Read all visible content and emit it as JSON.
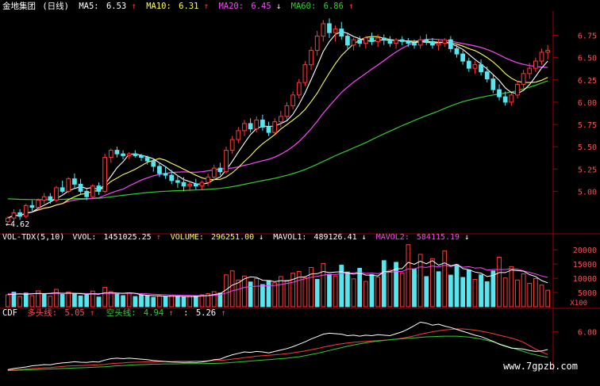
{
  "header": {
    "stock_name": "金地集团",
    "period": "(日线)",
    "ma5": {
      "label": "MA5:",
      "value": "6.53",
      "arrow": "↑"
    },
    "ma10": {
      "label": "MA10:",
      "value": "6.31",
      "arrow": "↑"
    },
    "ma20": {
      "label": "MA20:",
      "value": "6.45",
      "arrow": "↓"
    },
    "ma60": {
      "label": "MA60:",
      "value": "6.86",
      "arrow": "↑"
    }
  },
  "volume_header": {
    "indicator": "VOL-TDX(5,10)",
    "vvol": {
      "label": "VVOL:",
      "value": "1451025.25",
      "arrow": "↑"
    },
    "volume": {
      "label": "VOLUME:",
      "value": "296251.00",
      "arrow": "↓"
    },
    "mavol1": {
      "label": "MAVOL1:",
      "value": "489126.41",
      "arrow": "↓"
    },
    "mavol2": {
      "label": "MAVOL2:",
      "value": "584115.19",
      "arrow": "↓"
    }
  },
  "cdf_header": {
    "indicator": "CDF",
    "long_line": {
      "label": "多头线:",
      "value": "5.05",
      "arrow": "↑"
    },
    "short_line": {
      "label": "空头线:",
      "value": "4.94",
      "arrow": "↑"
    },
    "third": {
      "label": ":",
      "value": "5.26",
      "arrow": "↑"
    }
  },
  "low_marker": "←4.62",
  "watermark": "www.7gpzb.com",
  "colors": {
    "up": "#ff3b3b",
    "down": "#55e6ef",
    "ma5": "#ffffff",
    "ma10": "#ffff55",
    "ma20": "#ff44ff",
    "ma60": "#33cc33",
    "axis": "#a00000",
    "label": "#ff5050",
    "background": "#000000"
  },
  "chart_data": [
    {
      "type": "candlestick",
      "title": "金地集团 (日线)",
      "y_ticks": [
        "6.75",
        "6.50",
        "6.25",
        "6.00",
        "5.75",
        "5.50",
        "5.25",
        "5.00"
      ],
      "ylim": [
        4.55,
        6.95
      ],
      "candles": [
        [
          4.66,
          4.72,
          4.62,
          4.7
        ],
        [
          4.7,
          4.8,
          4.66,
          4.76
        ],
        [
          4.76,
          4.8,
          4.68,
          4.72
        ],
        [
          4.72,
          4.86,
          4.7,
          4.84
        ],
        [
          4.84,
          4.9,
          4.78,
          4.82
        ],
        [
          4.82,
          4.92,
          4.8,
          4.9
        ],
        [
          4.9,
          4.98,
          4.86,
          4.94
        ],
        [
          4.94,
          4.98,
          4.86,
          4.9
        ],
        [
          4.9,
          5.06,
          4.88,
          5.04
        ],
        [
          5.04,
          5.12,
          4.98,
          5.0
        ],
        [
          5.0,
          5.16,
          4.98,
          5.14
        ],
        [
          5.14,
          5.2,
          5.04,
          5.08
        ],
        [
          5.08,
          5.14,
          4.96,
          5.0
        ],
        [
          5.0,
          5.04,
          4.9,
          4.94
        ],
        [
          4.94,
          5.08,
          4.92,
          5.06
        ],
        [
          5.06,
          5.1,
          4.96,
          5.0
        ],
        [
          5.0,
          5.42,
          4.98,
          5.38
        ],
        [
          5.38,
          5.48,
          5.32,
          5.46
        ],
        [
          5.46,
          5.5,
          5.38,
          5.42
        ],
        [
          5.42,
          5.46,
          5.36,
          5.4
        ],
        [
          5.4,
          5.44,
          5.36,
          5.42
        ],
        [
          5.42,
          5.46,
          5.38,
          5.4
        ],
        [
          5.4,
          5.42,
          5.34,
          5.38
        ],
        [
          5.38,
          5.4,
          5.3,
          5.34
        ],
        [
          5.34,
          5.36,
          5.22,
          5.28
        ],
        [
          5.28,
          5.32,
          5.16,
          5.2
        ],
        [
          5.2,
          5.28,
          5.14,
          5.18
        ],
        [
          5.18,
          5.24,
          5.08,
          5.12
        ],
        [
          5.12,
          5.18,
          5.04,
          5.1
        ],
        [
          5.1,
          5.16,
          5.0,
          5.06
        ],
        [
          5.06,
          5.12,
          5.0,
          5.08
        ],
        [
          5.08,
          5.14,
          5.02,
          5.06
        ],
        [
          5.06,
          5.12,
          5.02,
          5.1
        ],
        [
          5.1,
          5.2,
          5.06,
          5.16
        ],
        [
          5.16,
          5.3,
          5.12,
          5.26
        ],
        [
          5.26,
          5.32,
          5.18,
          5.22
        ],
        [
          5.22,
          5.5,
          5.2,
          5.46
        ],
        [
          5.46,
          5.62,
          5.42,
          5.58
        ],
        [
          5.58,
          5.72,
          5.54,
          5.68
        ],
        [
          5.68,
          5.8,
          5.62,
          5.76
        ],
        [
          5.76,
          5.82,
          5.66,
          5.7
        ],
        [
          5.7,
          5.84,
          5.66,
          5.8
        ],
        [
          5.8,
          5.86,
          5.68,
          5.72
        ],
        [
          5.72,
          5.78,
          5.62,
          5.66
        ],
        [
          5.66,
          5.82,
          5.64,
          5.78
        ],
        [
          5.78,
          5.9,
          5.72,
          5.84
        ],
        [
          5.84,
          6.0,
          5.8,
          5.96
        ],
        [
          5.96,
          6.12,
          5.92,
          6.08
        ],
        [
          6.08,
          6.26,
          6.04,
          6.22
        ],
        [
          6.22,
          6.46,
          6.18,
          6.42
        ],
        [
          6.42,
          6.62,
          6.36,
          6.58
        ],
        [
          6.58,
          6.8,
          6.52,
          6.74
        ],
        [
          6.74,
          6.92,
          6.68,
          6.88
        ],
        [
          6.88,
          6.94,
          6.72,
          6.78
        ],
        [
          6.78,
          6.86,
          6.68,
          6.82
        ],
        [
          6.82,
          6.9,
          6.7,
          6.74
        ],
        [
          6.74,
          6.78,
          6.6,
          6.64
        ],
        [
          6.64,
          6.72,
          6.58,
          6.7
        ],
        [
          6.7,
          6.74,
          6.62,
          6.66
        ],
        [
          6.66,
          6.74,
          6.6,
          6.72
        ],
        [
          6.72,
          6.78,
          6.64,
          6.68
        ],
        [
          6.68,
          6.76,
          6.62,
          6.72
        ],
        [
          6.72,
          6.76,
          6.64,
          6.7
        ],
        [
          6.7,
          6.74,
          6.62,
          6.66
        ],
        [
          6.66,
          6.72,
          6.6,
          6.7
        ],
        [
          6.7,
          6.74,
          6.64,
          6.68
        ],
        [
          6.68,
          6.72,
          6.62,
          6.66
        ],
        [
          6.66,
          6.7,
          6.6,
          6.64
        ],
        [
          6.64,
          6.74,
          6.6,
          6.7
        ],
        [
          6.7,
          6.76,
          6.64,
          6.68
        ],
        [
          6.68,
          6.72,
          6.6,
          6.64
        ],
        [
          6.64,
          6.7,
          6.58,
          6.66
        ],
        [
          6.66,
          6.72,
          6.62,
          6.7
        ],
        [
          6.7,
          6.74,
          6.56,
          6.6
        ],
        [
          6.6,
          6.64,
          6.5,
          6.54
        ],
        [
          6.54,
          6.58,
          6.42,
          6.46
        ],
        [
          6.46,
          6.5,
          6.34,
          6.38
        ],
        [
          6.38,
          6.46,
          6.32,
          6.42
        ],
        [
          6.42,
          6.48,
          6.3,
          6.34
        ],
        [
          6.34,
          6.4,
          6.22,
          6.26
        ],
        [
          6.26,
          6.3,
          6.1,
          6.14
        ],
        [
          6.14,
          6.2,
          6.02,
          6.06
        ],
        [
          6.06,
          6.12,
          5.96,
          6.0
        ],
        [
          6.0,
          6.1,
          5.96,
          6.08
        ],
        [
          6.08,
          6.24,
          6.04,
          6.2
        ],
        [
          6.2,
          6.36,
          6.16,
          6.32
        ],
        [
          6.32,
          6.44,
          6.26,
          6.38
        ],
        [
          6.38,
          6.5,
          6.34,
          6.46
        ],
        [
          6.46,
          6.6,
          6.42,
          6.56
        ],
        [
          6.56,
          6.64,
          6.48,
          6.58
        ]
      ]
    },
    {
      "type": "bar",
      "title": "VOL-TDX(5,10)",
      "y_ticks": [
        "20000",
        "15000",
        "10000",
        "5000"
      ],
      "unit": "X100",
      "ylim": [
        0,
        22000
      ],
      "values": [
        4200,
        5100,
        3600,
        4800,
        3900,
        5600,
        4400,
        3700,
        6100,
        4300,
        5200,
        4600,
        3800,
        4100,
        5500,
        3400,
        6800,
        5300,
        4400,
        3900,
        4700,
        3600,
        4200,
        3800,
        3300,
        3900,
        3500,
        4100,
        3700,
        3400,
        3600,
        3900,
        4200,
        4600,
        5300,
        4800,
        11200,
        12600,
        9400,
        10800,
        8700,
        9900,
        7800,
        9200,
        8400,
        10600,
        9300,
        11800,
        12400,
        10200,
        13800,
        9600,
        15200,
        11400,
        10800,
        14600,
        12200,
        9800,
        13500,
        8900,
        11300,
        10400,
        16200,
        12800,
        15600,
        11900,
        21800,
        13200,
        18400,
        10600,
        16900,
        12300,
        19600,
        11100,
        14800,
        10300,
        12900,
        9600,
        11200,
        8800,
        12600,
        17400,
        10100,
        14100,
        9400,
        11600,
        8200,
        9900,
        7600,
        5800
      ],
      "up_flags": [
        1,
        0,
        1,
        0,
        1,
        1,
        0,
        1,
        1,
        0,
        1,
        0,
        0,
        0,
        1,
        0,
        1,
        1,
        0,
        0,
        1,
        0,
        0,
        0,
        0,
        1,
        0,
        1,
        0,
        0,
        1,
        0,
        1,
        1,
        1,
        0,
        1,
        1,
        1,
        1,
        0,
        1,
        0,
        0,
        1,
        1,
        1,
        1,
        1,
        1,
        1,
        0,
        1,
        0,
        1,
        0,
        0,
        1,
        0,
        1,
        0,
        1,
        0,
        1,
        0,
        1,
        1,
        0,
        1,
        0,
        1,
        0,
        1,
        0,
        0,
        0,
        0,
        1,
        0,
        0,
        0,
        1,
        1,
        1,
        1,
        1,
        1,
        1,
        1,
        1
      ],
      "mavol1": [
        4300,
        4400,
        4500,
        4400,
        4500,
        4700,
        4600,
        4700,
        4900,
        4700,
        4800,
        4700,
        4600,
        4400,
        4500,
        4400,
        4900,
        4900,
        4800,
        4700,
        4900,
        4700,
        4200,
        4000,
        3900,
        3800,
        3700,
        3700,
        3700,
        3600,
        3600,
        3600,
        3800,
        3900,
        4300,
        4600,
        6000,
        7600,
        8400,
        9800,
        10500,
        10300,
        9300,
        9200,
        8800,
        9200,
        9000,
        9600,
        10400,
        10500,
        11500,
        11600,
        12400,
        12000,
        12200,
        12300,
        11800,
        11500,
        11900,
        11100,
        11100,
        10800,
        12300,
        12400,
        13300,
        13400,
        15600,
        14900,
        16000,
        15100,
        16200,
        14600,
        15400,
        14400,
        14900,
        13400,
        13000,
        12200,
        11800,
        10600,
        11000,
        12000,
        12000,
        12900,
        12700,
        12500,
        11300,
        10600,
        9200,
        8400
      ],
      "mavol2": [
        4500,
        4500,
        4500,
        4500,
        4600,
        4600,
        4600,
        4600,
        4700,
        4700,
        4700,
        4700,
        4700,
        4600,
        4600,
        4600,
        4700,
        4700,
        4700,
        4700,
        4700,
        4700,
        4600,
        4500,
        4400,
        4300,
        4200,
        4100,
        4100,
        4000,
        4000,
        3900,
        3900,
        3900,
        4000,
        4200,
        4800,
        5600,
        6100,
        6800,
        7100,
        7200,
        7300,
        7400,
        7500,
        7800,
        8200,
        8600,
        9300,
        9800,
        10400,
        10700,
        11100,
        11400,
        11300,
        11600,
        11700,
        11900,
        12200,
        11700,
        11800,
        11600,
        12100,
        12100,
        12400,
        12400,
        13300,
        13300,
        14000,
        13800,
        14300,
        14000,
        14600,
        14100,
        14700,
        13900,
        14100,
        13600,
        13700,
        12900,
        13100,
        13100,
        13100,
        13300,
        13200,
        12600,
        12100,
        11500,
        10800,
        10300
      ]
    },
    {
      "type": "line",
      "title": "CDF",
      "y_ticks": [
        "6.00"
      ],
      "ylim": [
        4.3,
        6.55
      ],
      "series": [
        {
          "name": "多头线",
          "values": [
            4.4,
            4.42,
            4.43,
            4.45,
            4.47,
            4.48,
            4.5,
            4.51,
            4.53,
            4.55,
            4.57,
            4.58,
            4.59,
            4.6,
            4.61,
            4.62,
            4.64,
            4.67,
            4.69,
            4.7,
            4.72,
            4.73,
            4.74,
            4.75,
            4.75,
            4.76,
            4.76,
            4.76,
            4.77,
            4.77,
            4.77,
            4.78,
            4.78,
            4.79,
            4.8,
            4.81,
            4.83,
            4.86,
            4.89,
            4.92,
            4.95,
            4.98,
            5.0,
            5.02,
            5.04,
            5.06,
            5.09,
            5.12,
            5.16,
            5.2,
            5.25,
            5.3,
            5.36,
            5.41,
            5.46,
            5.5,
            5.53,
            5.56,
            5.58,
            5.6,
            5.62,
            5.63,
            5.65,
            5.67,
            5.7,
            5.73,
            5.78,
            5.83,
            5.9,
            5.95,
            6.0,
            6.04,
            6.08,
            6.1,
            6.12,
            6.12,
            6.1,
            6.07,
            6.03,
            5.98,
            5.92,
            5.86,
            5.8,
            5.74,
            5.66,
            5.56,
            5.42,
            5.28,
            5.16,
            5.05
          ]
        },
        {
          "name": "空头线",
          "values": [
            4.38,
            4.39,
            4.4,
            4.41,
            4.42,
            4.43,
            4.44,
            4.45,
            4.46,
            4.47,
            4.48,
            4.49,
            4.5,
            4.51,
            4.52,
            4.53,
            4.54,
            4.56,
            4.58,
            4.59,
            4.61,
            4.62,
            4.63,
            4.64,
            4.65,
            4.65,
            4.66,
            4.66,
            4.66,
            4.67,
            4.67,
            4.67,
            4.67,
            4.68,
            4.68,
            4.69,
            4.7,
            4.72,
            4.74,
            4.76,
            4.78,
            4.8,
            4.82,
            4.84,
            4.86,
            4.88,
            4.9,
            4.93,
            4.96,
            5.0,
            5.05,
            5.1,
            5.16,
            5.22,
            5.28,
            5.34,
            5.4,
            5.45,
            5.5,
            5.54,
            5.58,
            5.61,
            5.64,
            5.67,
            5.69,
            5.71,
            5.73,
            5.75,
            5.77,
            5.79,
            5.8,
            5.81,
            5.82,
            5.82,
            5.82,
            5.8,
            5.78,
            5.74,
            5.7,
            5.64,
            5.58,
            5.5,
            5.42,
            5.34,
            5.26,
            5.18,
            5.1,
            5.04,
            4.98,
            4.94
          ]
        },
        {
          "name": "",
          "values": [
            4.42,
            4.47,
            4.5,
            4.53,
            4.58,
            4.6,
            4.63,
            4.62,
            4.67,
            4.7,
            4.72,
            4.75,
            4.73,
            4.72,
            4.75,
            4.74,
            4.82,
            4.88,
            4.9,
            4.88,
            4.9,
            4.88,
            4.86,
            4.84,
            4.8,
            4.78,
            4.76,
            4.74,
            4.73,
            4.72,
            4.73,
            4.72,
            4.74,
            4.78,
            4.84,
            4.86,
            4.96,
            5.04,
            5.1,
            5.16,
            5.14,
            5.18,
            5.16,
            5.12,
            5.18,
            5.24,
            5.3,
            5.38,
            5.48,
            5.58,
            5.7,
            5.8,
            5.9,
            5.94,
            5.92,
            5.9,
            5.84,
            5.86,
            5.82,
            5.86,
            5.84,
            5.88,
            5.86,
            5.84,
            5.92,
            6.0,
            6.12,
            6.26,
            6.4,
            6.36,
            6.28,
            6.32,
            6.24,
            6.18,
            6.1,
            6.02,
            5.94,
            5.86,
            5.8,
            5.7,
            5.6,
            5.48,
            5.4,
            5.32,
            5.3,
            5.28,
            5.22,
            5.18,
            5.2,
            5.26
          ]
        }
      ]
    }
  ]
}
